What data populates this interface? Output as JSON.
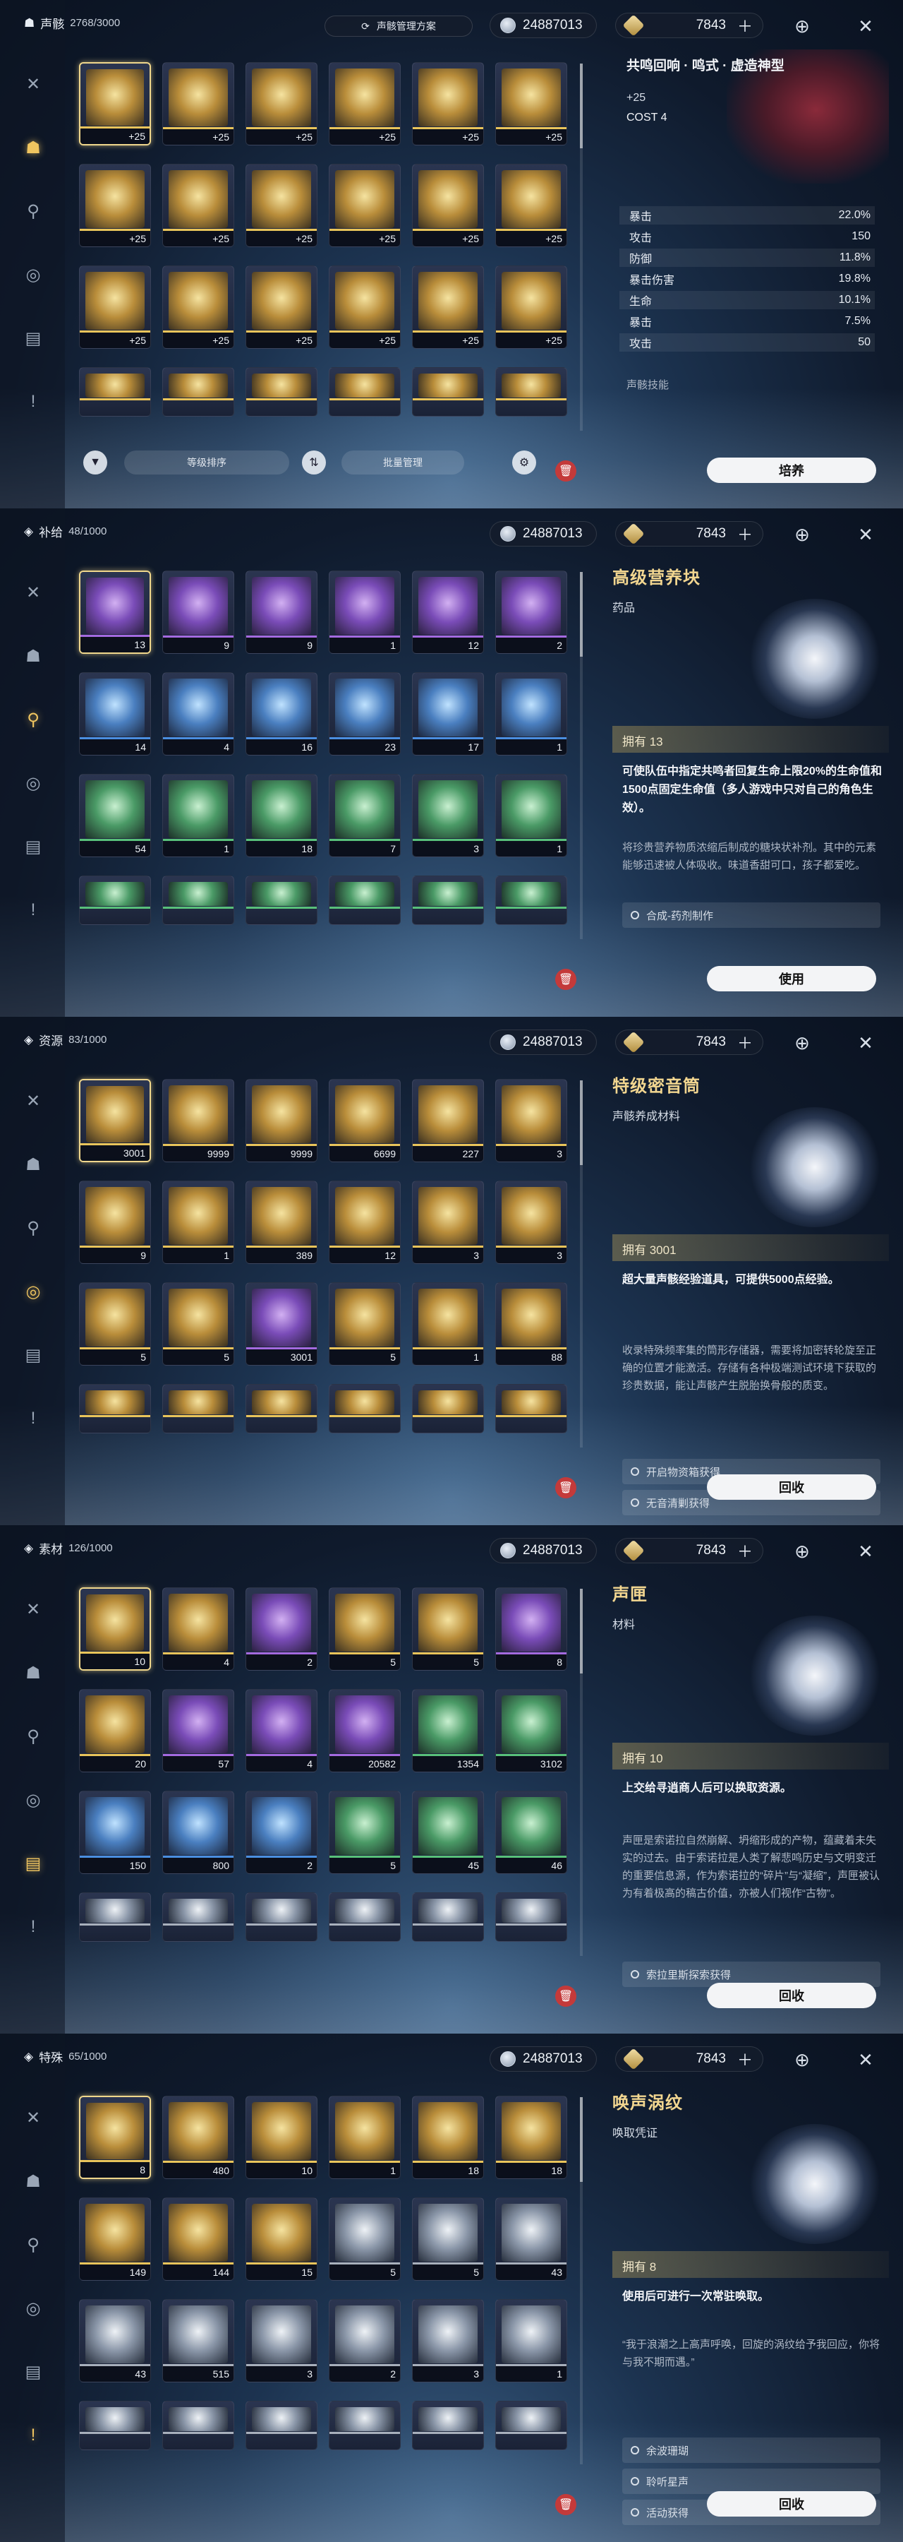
{
  "header": {
    "coins": "24887013",
    "stars": "7843"
  },
  "panel1": {
    "title": "声骸",
    "count": "2768/3000",
    "plan_button": "声骸管理方案",
    "echo_name": "共鸣回响 · 鸣式 · 虚造神型",
    "level": "+25",
    "cost": "COST 4",
    "stats": [
      {
        "name": "暴击",
        "value": "22.0%"
      },
      {
        "name": "攻击",
        "value": "150"
      },
      {
        "name": "防御",
        "value": "11.8%"
      },
      {
        "name": "暴击伤害",
        "value": "19.8%"
      },
      {
        "name": "生命",
        "value": "10.1%"
      },
      {
        "name": "暴击",
        "value": "7.5%"
      },
      {
        "name": "攻击",
        "value": "50"
      }
    ],
    "skill_label": "声骸技能",
    "sort_label": "等级排序",
    "batch_label": "批量管理",
    "action": "培养",
    "slots": [
      {
        "q": "+25",
        "r": "gold",
        "sel": true
      },
      {
        "q": "+25",
        "r": "gold"
      },
      {
        "q": "+25",
        "r": "gold"
      },
      {
        "q": "+25",
        "r": "gold"
      },
      {
        "q": "+25",
        "r": "gold"
      },
      {
        "q": "+25",
        "r": "gold"
      },
      {
        "q": "+25",
        "r": "gold"
      },
      {
        "q": "+25",
        "r": "gold"
      },
      {
        "q": "+25",
        "r": "gold"
      },
      {
        "q": "+25",
        "r": "gold"
      },
      {
        "q": "+25",
        "r": "gold"
      },
      {
        "q": "+25",
        "r": "gold"
      },
      {
        "q": "+25",
        "r": "gold"
      },
      {
        "q": "+25",
        "r": "gold"
      },
      {
        "q": "+25",
        "r": "gold"
      },
      {
        "q": "+25",
        "r": "gold"
      },
      {
        "q": "+25",
        "r": "gold"
      },
      {
        "q": "+25",
        "r": "gold"
      },
      {
        "q": "",
        "r": "gold"
      },
      {
        "q": "",
        "r": "gold"
      },
      {
        "q": "",
        "r": "gold"
      },
      {
        "q": "",
        "r": "gold"
      },
      {
        "q": "",
        "r": "gold"
      },
      {
        "q": "",
        "r": "gold"
      }
    ]
  },
  "panel2": {
    "title": "补给",
    "count": "48/1000",
    "item_name": "高级营养块",
    "item_type": "药品",
    "own": "拥有 13",
    "effect": "可使队伍中指定共鸣者回复生命上限20%的生命值和1500点固定生命值（多人游戏中只对自己的角色生效）。",
    "desc": "将珍贵营养物质浓缩后制成的糖块状补剂。其中的元素能够迅速被人体吸收。味道香甜可口，孩子都爱吃。",
    "sources": [
      "合成-药剂制作"
    ],
    "action": "使用",
    "slots": [
      {
        "q": "13",
        "r": "purple",
        "sel": true
      },
      {
        "q": "9",
        "r": "purple"
      },
      {
        "q": "9",
        "r": "purple"
      },
      {
        "q": "1",
        "r": "purple"
      },
      {
        "q": "12",
        "r": "purple"
      },
      {
        "q": "2",
        "r": "purple"
      },
      {
        "q": "14",
        "r": "blue"
      },
      {
        "q": "4",
        "r": "blue"
      },
      {
        "q": "16",
        "r": "blue"
      },
      {
        "q": "23",
        "r": "blue"
      },
      {
        "q": "17",
        "r": "blue"
      },
      {
        "q": "1",
        "r": "blue"
      },
      {
        "q": "54",
        "r": "green"
      },
      {
        "q": "1",
        "r": "green"
      },
      {
        "q": "18",
        "r": "green"
      },
      {
        "q": "7",
        "r": "green"
      },
      {
        "q": "3",
        "r": "green"
      },
      {
        "q": "1",
        "r": "green"
      },
      {
        "q": "",
        "r": "green"
      },
      {
        "q": "",
        "r": "green"
      },
      {
        "q": "",
        "r": "green"
      },
      {
        "q": "",
        "r": "green"
      },
      {
        "q": "",
        "r": "green"
      },
      {
        "q": "",
        "r": "green"
      }
    ]
  },
  "panel3": {
    "title": "资源",
    "count": "83/1000",
    "item_name": "特级密音筒",
    "item_type": "声骸养成材料",
    "own": "拥有 3001",
    "effect": "超大量声骸经验道具，可提供5000点经验。",
    "desc": "收录特殊频率集的筒形存储器，需要将加密转轮旋至正确的位置才能激活。存储有各种极端测试环境下获取的珍贵数据，能让声骸产生脱胎换骨般的质变。",
    "sources": [
      "开启物资箱获得",
      "无音清剿获得"
    ],
    "action": "回收",
    "slots": [
      {
        "q": "3001",
        "r": "gold",
        "sel": true
      },
      {
        "q": "9999",
        "r": "gold"
      },
      {
        "q": "9999",
        "r": "gold"
      },
      {
        "q": "6699",
        "r": "gold"
      },
      {
        "q": "227",
        "r": "gold"
      },
      {
        "q": "3",
        "r": "gold"
      },
      {
        "q": "9",
        "r": "gold"
      },
      {
        "q": "1",
        "r": "gold"
      },
      {
        "q": "389",
        "r": "gold"
      },
      {
        "q": "12",
        "r": "gold"
      },
      {
        "q": "3",
        "r": "gold"
      },
      {
        "q": "3",
        "r": "gold"
      },
      {
        "q": "5",
        "r": "gold"
      },
      {
        "q": "5",
        "r": "gold"
      },
      {
        "q": "3001",
        "r": "purple"
      },
      {
        "q": "5",
        "r": "gold"
      },
      {
        "q": "1",
        "r": "gold"
      },
      {
        "q": "88",
        "r": "gold"
      },
      {
        "q": "",
        "r": "gold"
      },
      {
        "q": "",
        "r": "gold"
      },
      {
        "q": "",
        "r": "gold"
      },
      {
        "q": "",
        "r": "gold"
      },
      {
        "q": "",
        "r": "gold"
      },
      {
        "q": "",
        "r": "gold"
      }
    ]
  },
  "panel4": {
    "title": "素材",
    "count": "126/1000",
    "item_name": "声匣",
    "item_type": "材料",
    "own": "拥有 10",
    "effect": "上交给寻逍商人后可以换取资源。",
    "desc": "声匣是索诺拉自然崩解、坍缩形成的产物，蕴藏着未失实的过去。由于索诺拉是人类了解悲鸣历史与文明变迁的重要信息源，作为索诺拉的“碎片”与“凝缩”，声匣被认为有着极高的稿古价值，亦被人们视作“古物”。",
    "sources": [
      "索拉里斯探索获得"
    ],
    "action": "回收",
    "slots": [
      {
        "q": "10",
        "r": "gold",
        "sel": true
      },
      {
        "q": "4",
        "r": "gold"
      },
      {
        "q": "2",
        "r": "purple"
      },
      {
        "q": "5",
        "r": "gold"
      },
      {
        "q": "5",
        "r": "gold"
      },
      {
        "q": "8",
        "r": "purple"
      },
      {
        "q": "20",
        "r": "gold"
      },
      {
        "q": "57",
        "r": "purple"
      },
      {
        "q": "4",
        "r": "purple"
      },
      {
        "q": "20582",
        "r": "purple"
      },
      {
        "q": "1354",
        "r": "green"
      },
      {
        "q": "3102",
        "r": "green"
      },
      {
        "q": "150",
        "r": "blue"
      },
      {
        "q": "800",
        "r": "blue"
      },
      {
        "q": "2",
        "r": "blue"
      },
      {
        "q": "5",
        "r": "green"
      },
      {
        "q": "45",
        "r": "green"
      },
      {
        "q": "46",
        "r": "green"
      },
      {
        "q": "",
        "r": "white"
      },
      {
        "q": "",
        "r": "white"
      },
      {
        "q": "",
        "r": "white"
      },
      {
        "q": "",
        "r": "white"
      },
      {
        "q": "",
        "r": "white"
      },
      {
        "q": "",
        "r": "white"
      }
    ]
  },
  "panel5": {
    "title": "特殊",
    "count": "65/1000",
    "item_name": "唤声涡纹",
    "item_type": "唤取凭证",
    "own": "拥有 8",
    "effect": "使用后可进行一次常驻唤取。",
    "desc": "“我于浪潮之上高声呼唤，回旋的涡纹给予我回应，你将与我不期而遇。”",
    "sources": [
      "余波珊瑚",
      "聆听星声",
      "活动获得"
    ],
    "action": "回收",
    "slots": [
      {
        "q": "8",
        "r": "gold",
        "sel": true
      },
      {
        "q": "480",
        "r": "gold"
      },
      {
        "q": "10",
        "r": "gold"
      },
      {
        "q": "1",
        "r": "gold"
      },
      {
        "q": "18",
        "r": "gold"
      },
      {
        "q": "18",
        "r": "gold"
      },
      {
        "q": "149",
        "r": "gold"
      },
      {
        "q": "144",
        "r": "gold"
      },
      {
        "q": "15",
        "r": "gold"
      },
      {
        "q": "5",
        "r": "white"
      },
      {
        "q": "5",
        "r": "white"
      },
      {
        "q": "43",
        "r": "white"
      },
      {
        "q": "43",
        "r": "white"
      },
      {
        "q": "515",
        "r": "white"
      },
      {
        "q": "3",
        "r": "white"
      },
      {
        "q": "2",
        "r": "white"
      },
      {
        "q": "3",
        "r": "white"
      },
      {
        "q": "1",
        "r": "white"
      },
      {
        "q": "",
        "r": "white"
      },
      {
        "q": "",
        "r": "white"
      },
      {
        "q": "",
        "r": "white"
      },
      {
        "q": "",
        "r": "white"
      },
      {
        "q": "",
        "r": "white"
      },
      {
        "q": "",
        "r": "white"
      }
    ]
  },
  "icons": {
    "close": "close-icon",
    "target": "target-icon",
    "plus": "plus-icon",
    "trash": "trash-icon"
  }
}
